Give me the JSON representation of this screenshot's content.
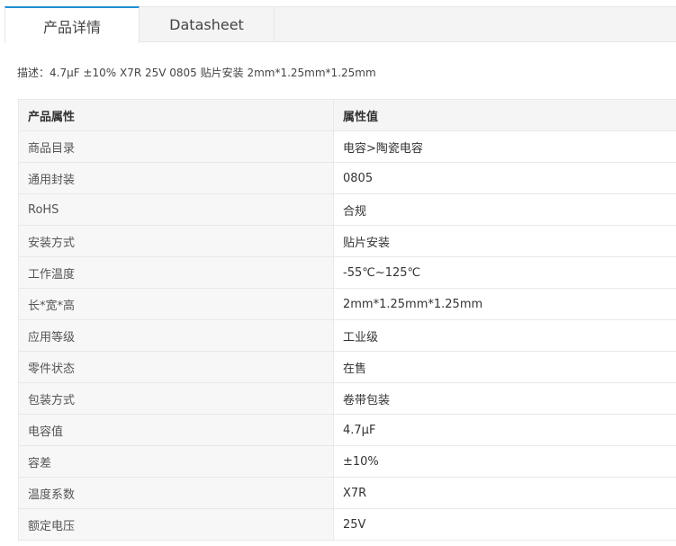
{
  "tabs": [
    {
      "label": "产品详情",
      "active": true
    },
    {
      "label": "Datasheet",
      "active": false
    }
  ],
  "description": "描述：4.7μF ±10% X7R 25V 0805 贴片安装 2mm*1.25mm*1.25mm",
  "table": {
    "headers": [
      "产品属性",
      "属性值"
    ],
    "rows": [
      [
        "商品目录",
        "电容>陶瓷电容"
      ],
      [
        "通用封装",
        "0805"
      ],
      [
        "RoHS",
        "合规"
      ],
      [
        "安装方式",
        "贴片安装"
      ],
      [
        "工作温度",
        "-55℃~125℃"
      ],
      [
        "长*宽*高",
        "2mm*1.25mm*1.25mm"
      ],
      [
        "应用等级",
        "工业级"
      ],
      [
        "零件状态",
        "在售"
      ],
      [
        "包装方式",
        "卷带包装"
      ],
      [
        "电容值",
        "4.7μF"
      ],
      [
        "容差",
        "±10%"
      ],
      [
        "温度系数",
        "X7R"
      ],
      [
        "额定电压",
        "25V"
      ]
    ]
  },
  "colors": {
    "tab_active_accent": "#1e8fd6",
    "header_bg": "#f5f5f5",
    "key_cell_bg": "#f7f7f7"
  }
}
